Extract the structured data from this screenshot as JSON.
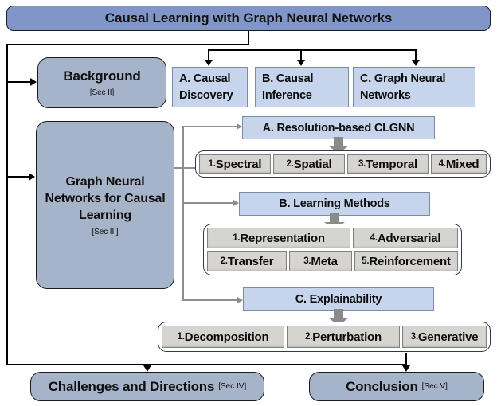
{
  "title": "Causal Learning with Graph Neural Networks",
  "major_boxes": {
    "background": {
      "title": "Background",
      "section": "[Sec II]"
    },
    "gnn": {
      "title": "Graph Neural Networks for Causal Learning",
      "section": "[Sec III]"
    }
  },
  "background_children": [
    {
      "label": "A. Causal Discovery"
    },
    {
      "label": "B. Causal Inference"
    },
    {
      "label": "C. Graph Neural Networks"
    }
  ],
  "gnn_children": {
    "resolution": {
      "label": "A. Resolution-based CLGNN",
      "items": [
        {
          "num": "1.",
          "word": "Spectral"
        },
        {
          "num": "2.",
          "word": "Spatial"
        },
        {
          "num": "3.",
          "word": "Temporal"
        },
        {
          "num": "4.",
          "word": "Mixed"
        }
      ]
    },
    "learning": {
      "label": "B. Learning Methods",
      "row1": [
        {
          "num": "1.",
          "word": "Representation"
        },
        {
          "num": "4.",
          "word": "Adversarial"
        }
      ],
      "row2": [
        {
          "num": "2.",
          "word": "Transfer"
        },
        {
          "num": "3.",
          "word": "Meta"
        },
        {
          "num": "5.",
          "word": "Reinforcement"
        }
      ]
    },
    "explainability": {
      "label": "C. Explainability",
      "items": [
        {
          "num": "1.",
          "word": "Decomposition"
        },
        {
          "num": "2.",
          "word": "Perturbation"
        },
        {
          "num": "3.",
          "word": "Generative"
        }
      ]
    }
  },
  "bottom_boxes": [
    {
      "title": "Challenges and Directions",
      "section": "[Sec IV]"
    },
    {
      "title": "Conclusion",
      "section": "[Sec V]"
    }
  ],
  "colors": {
    "title_blue": "#8096c8",
    "major_blue": "#a6b4ca",
    "light_blue": "#c7d5ec",
    "cell_grey": "#d6d4d1",
    "connector_grey": "#8d8d8d",
    "connector_black": "#000000"
  }
}
